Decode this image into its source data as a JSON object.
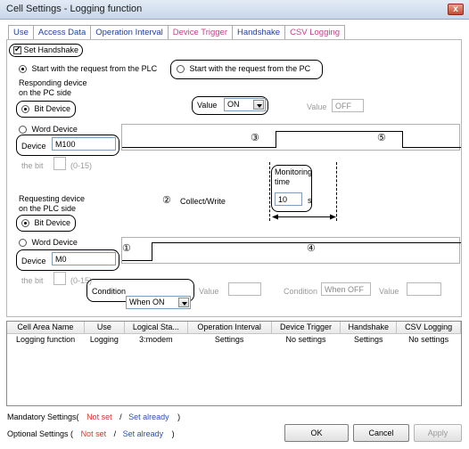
{
  "window": {
    "title": "Cell Settings - Logging function",
    "close_glyph": "x"
  },
  "tabs": [
    {
      "label": "Use"
    },
    {
      "label": "Access Data"
    },
    {
      "label": "Operation Interval"
    },
    {
      "label": "Device Trigger"
    },
    {
      "label": "Handshake"
    },
    {
      "label": "CSV Logging"
    }
  ],
  "handshake": {
    "set_handshake_label": "Set Handshake",
    "start_plc_label": "Start with the request from the PLC",
    "start_pc_label": "Start with the request from the PC",
    "pc_side": {
      "heading_line1": "Responding device",
      "heading_line2": "on the PC side",
      "bit_device_label": "Bit Device",
      "word_device_label": "Word Device",
      "device_label": "Device",
      "device_value": "M100",
      "the_bit_label": "the bit",
      "bit_range": "(0-15)",
      "value_label": "Value",
      "value_selected": "ON",
      "value_disabled_label": "Value",
      "value_disabled": "OFF"
    },
    "collect_write_label": "Collect/Write",
    "monitoring": {
      "label_line1": "Monitoring",
      "label_line2": "time",
      "value": "10",
      "unit": "s"
    },
    "plc_side": {
      "heading_line1": "Requesting device",
      "heading_line2": "on the PLC side",
      "bit_device_label": "Bit Device",
      "word_device_label": "Word Device",
      "device_label": "Device",
      "device_value": "M0",
      "the_bit_label": "the bit",
      "bit_range": "(0-15)",
      "condition_label": "Condition",
      "condition_selected": "When ON",
      "value_label": "Value",
      "condition2_label": "Condition",
      "condition2_value": "When OFF",
      "value2_label": "Value"
    },
    "markers": {
      "m1": "①",
      "m2": "②",
      "m3": "③",
      "m4": "④",
      "m5": "⑤"
    }
  },
  "grid": {
    "columns": [
      "Cell Area Name",
      "Use",
      "Logical Sta...",
      "Operation Interval",
      "Device Trigger",
      "Handshake",
      "CSV Logging"
    ],
    "rows": [
      [
        "Logging function",
        "Logging",
        "3:modem",
        "Settings",
        "No settings",
        "Settings",
        "No settings"
      ]
    ]
  },
  "footer": {
    "mandatory_label": "Mandatory Settings(",
    "optional_label": "Optional Settings  (",
    "not_set": "Not set",
    "slash": "/",
    "set_already": "Set already",
    "close_paren": ")",
    "ok": "OK",
    "cancel": "Cancel",
    "apply": "Apply"
  }
}
